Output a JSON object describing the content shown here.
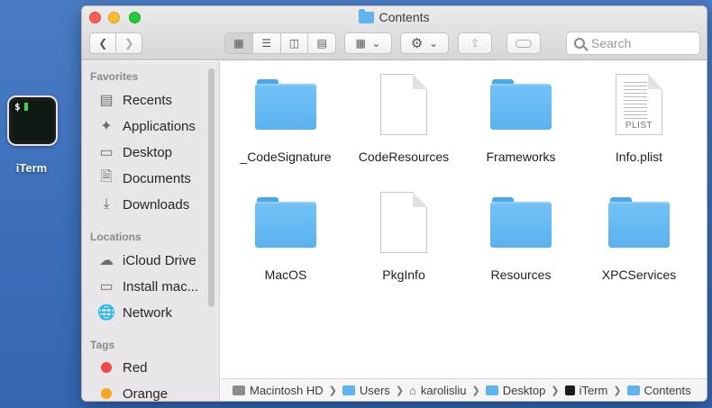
{
  "desktop": {
    "app_label": "iTerm",
    "icon_prompt": "$"
  },
  "window": {
    "title": "Contents"
  },
  "toolbar": {
    "search_placeholder": "Search"
  },
  "sidebar": {
    "favorites_heading": "Favorites",
    "favorites": [
      {
        "label": "Recents",
        "icon": "clock-icon"
      },
      {
        "label": "Applications",
        "icon": "applications-icon"
      },
      {
        "label": "Desktop",
        "icon": "desktop-icon"
      },
      {
        "label": "Documents",
        "icon": "document-icon"
      },
      {
        "label": "Downloads",
        "icon": "download-icon"
      }
    ],
    "locations_heading": "Locations",
    "locations": [
      {
        "label": "iCloud Drive",
        "icon": "cloud-icon"
      },
      {
        "label": "Install mac...",
        "icon": "disk-icon"
      },
      {
        "label": "Network",
        "icon": "globe-icon"
      }
    ],
    "tags_heading": "Tags",
    "tags": [
      {
        "label": "Red",
        "color": "#f04848"
      },
      {
        "label": "Orange",
        "color": "#f5a623"
      }
    ]
  },
  "files": [
    {
      "name": "_CodeSignature",
      "kind": "folder"
    },
    {
      "name": "CodeResources",
      "kind": "document"
    },
    {
      "name": "Frameworks",
      "kind": "folder"
    },
    {
      "name": "Info.plist",
      "kind": "plist",
      "badge": "PLIST"
    },
    {
      "name": "MacOS",
      "kind": "folder"
    },
    {
      "name": "PkgInfo",
      "kind": "document"
    },
    {
      "name": "Resources",
      "kind": "folder"
    },
    {
      "name": "XPCServices",
      "kind": "folder"
    }
  ],
  "pathbar": {
    "crumbs": [
      {
        "label": "Macintosh HD",
        "icon": "hard-drive-icon"
      },
      {
        "label": "Users",
        "icon": "folder-icon"
      },
      {
        "label": "karolisliu",
        "icon": "home-icon"
      },
      {
        "label": "Desktop",
        "icon": "folder-icon"
      },
      {
        "label": "iTerm",
        "icon": "terminal-icon"
      },
      {
        "label": "Contents",
        "icon": "folder-icon"
      }
    ]
  },
  "colors": {
    "folder": "#5ab2ee",
    "desktop_bg": "#3b6fba"
  }
}
